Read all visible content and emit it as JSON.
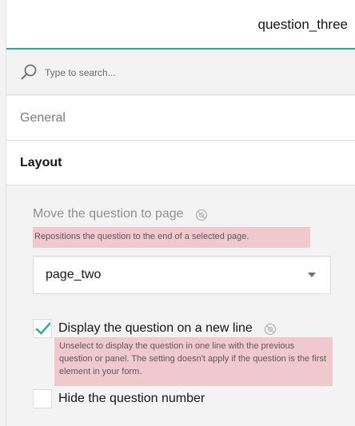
{
  "header": {
    "title": "question_three"
  },
  "search": {
    "placeholder": "Type to search..."
  },
  "sections": {
    "general": "General",
    "layout": "Layout"
  },
  "layout": {
    "move_question": {
      "label": "Move the question to page",
      "description": "Repositions the question to the end of a selected page.",
      "selected_value": "page_two"
    },
    "new_line": {
      "label": "Display the question on a new line",
      "checked": true,
      "description": "Unselect to display the question in one line with the previous question or panel. The setting doesn't apply if the question is the first element in your form."
    },
    "hide_number": {
      "label": "Hide the question number",
      "checked": false
    }
  },
  "colors": {
    "accent": "#19b394",
    "highlight": "#f0c9cf"
  },
  "icons": {
    "search": "search-icon",
    "help": "help-icon",
    "dropdown": "chevron-down-icon",
    "check": "check-icon"
  }
}
